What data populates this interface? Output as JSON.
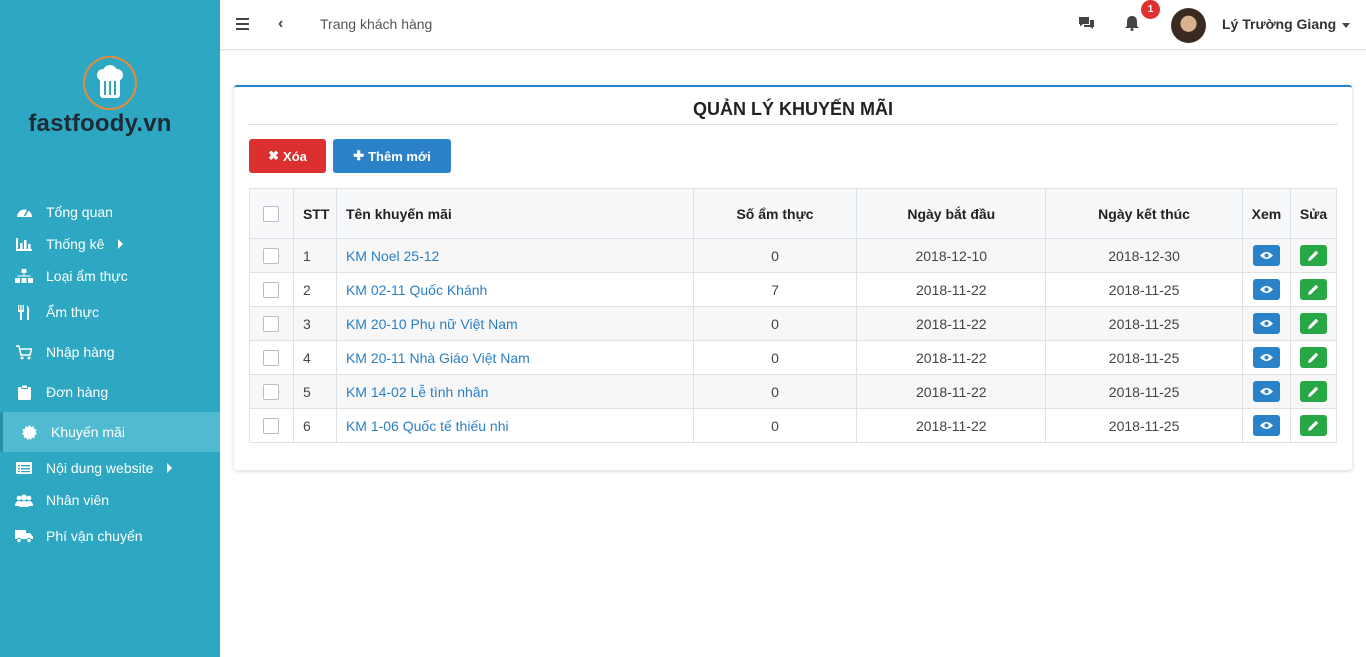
{
  "brand": {
    "logo_text": "fastfoody.vn"
  },
  "sidebar": {
    "items": [
      {
        "label": "Tổng quan",
        "icon": "dashboard-icon"
      },
      {
        "label": "Thống kê",
        "icon": "bar-chart-icon",
        "submenu": true
      },
      {
        "label": "Loại ẩm thực",
        "icon": "sitemap-icon"
      },
      {
        "label": "Ẩm thực",
        "icon": "cutlery-icon"
      },
      {
        "label": "Nhập hàng",
        "icon": "cart-icon"
      },
      {
        "label": "Đơn hàng",
        "icon": "clipboard-icon"
      },
      {
        "label": "Khuyến mãi",
        "icon": "badge-icon",
        "active": true
      },
      {
        "label": "Nội dung website",
        "icon": "list-icon",
        "submenu": true
      },
      {
        "label": "Nhân viên",
        "icon": "users-icon"
      },
      {
        "label": "Phí vận chuyển",
        "icon": "truck-icon"
      }
    ]
  },
  "topbar": {
    "breadcrumb": "Trang khách hàng",
    "notification_count": "1",
    "user_name": "Lý Trường Giang"
  },
  "page": {
    "title": "QUẢN LÝ KHUYẾN MÃI",
    "delete_label": "Xóa",
    "add_label": "Thêm mới"
  },
  "table": {
    "headers": {
      "stt": "STT",
      "name": "Tên khuyến mãi",
      "count": "Số ẩm thực",
      "start": "Ngày bắt đầu",
      "end": "Ngày kết thúc",
      "view": "Xem",
      "edit": "Sửa"
    },
    "rows": [
      {
        "stt": "1",
        "name": "KM Noel 25-12",
        "count": "0",
        "start": "2018-12-10",
        "end": "2018-12-30"
      },
      {
        "stt": "2",
        "name": "KM 02-11 Quốc Khánh",
        "count": "7",
        "start": "2018-11-22",
        "end": "2018-11-25"
      },
      {
        "stt": "3",
        "name": "KM 20-10 Phụ nữ Việt Nam",
        "count": "0",
        "start": "2018-11-22",
        "end": "2018-11-25"
      },
      {
        "stt": "4",
        "name": "KM 20-11 Nhà Giáo Việt Nam",
        "count": "0",
        "start": "2018-11-22",
        "end": "2018-11-25"
      },
      {
        "stt": "5",
        "name": "KM 14-02 Lễ tình nhân",
        "count": "0",
        "start": "2018-11-22",
        "end": "2018-11-25"
      },
      {
        "stt": "6",
        "name": "KM 1-06 Quốc tế thiếu nhi",
        "count": "0",
        "start": "2018-11-22",
        "end": "2018-11-25"
      }
    ]
  },
  "colors": {
    "sidebar": "#2ea8c2",
    "primary": "#2a82c9",
    "danger": "#dc2f2f",
    "success": "#28a745",
    "link": "#2b7fc4"
  }
}
